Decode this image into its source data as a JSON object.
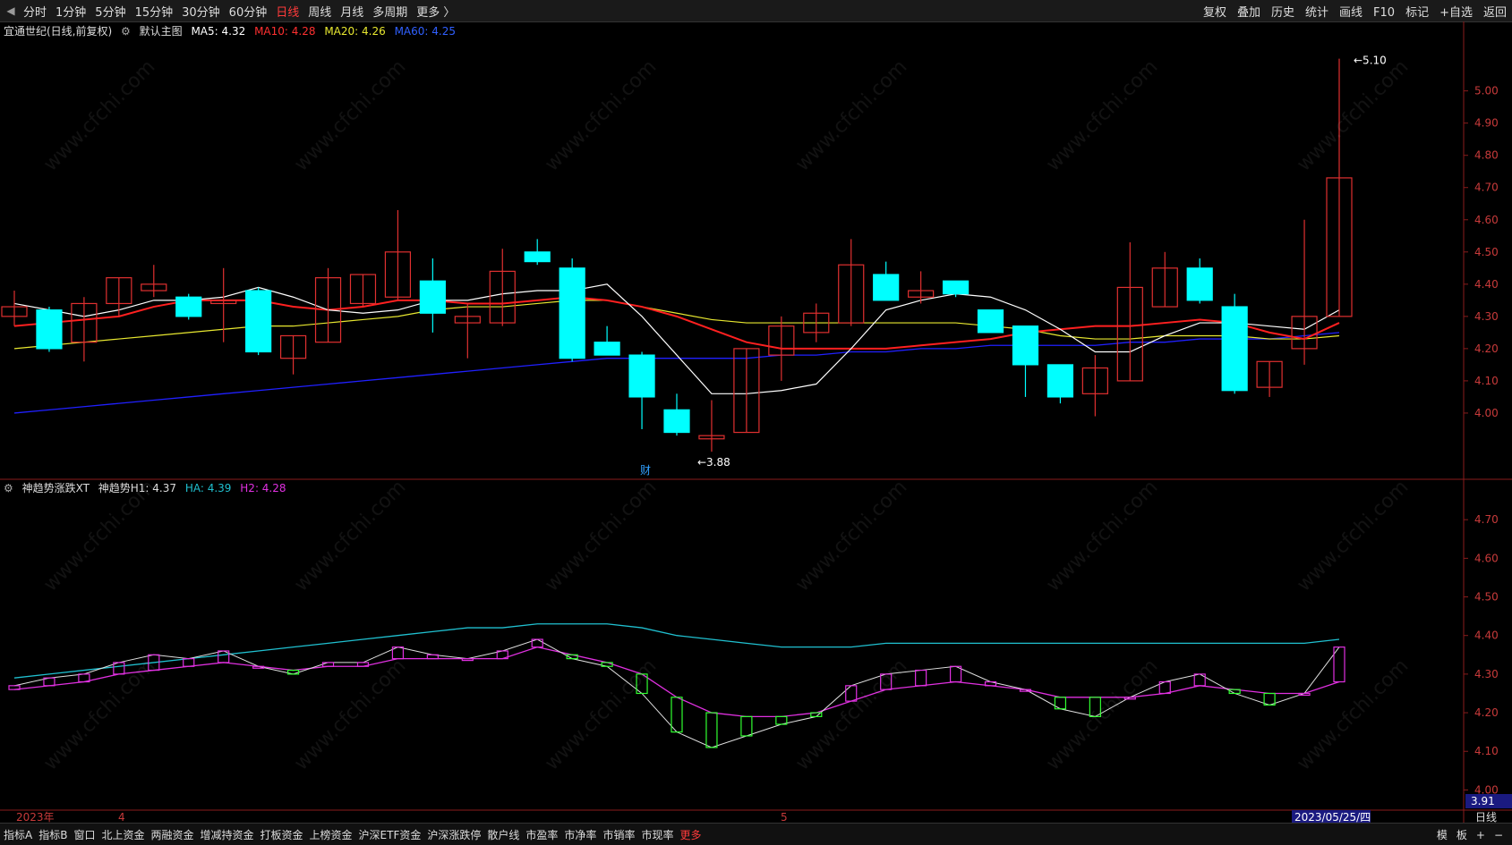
{
  "topbar": {
    "nav": [
      "分时",
      "1分钟",
      "5分钟",
      "15分钟",
      "30分钟",
      "60分钟",
      "日线",
      "周线",
      "月线",
      "多周期",
      "更多 〉"
    ],
    "active_index": 6,
    "tools": [
      "复权",
      "叠加",
      "历史",
      "统计",
      "画线",
      "F10",
      "标记",
      "+自选",
      "返回"
    ]
  },
  "main_info": {
    "stock": "宜通世纪(日线,前复权)",
    "indicator": "默认主图",
    "ma5": "MA5: 4.32",
    "ma10": "MA10: 4.28",
    "ma20": "MA20: 4.26",
    "ma60": "MA60: 4.25"
  },
  "sub_info": {
    "name": "神趋势涨跌XT",
    "h1": "神趋势H1: 4.37",
    "ha": "HA: 4.39",
    "h2": "H2: 4.28"
  },
  "colors": {
    "ma5": "#ffffff",
    "ma10": "#ff2020",
    "ma20": "#e8e830",
    "ma60": "#2020ff",
    "up": "#e03030",
    "down": "#00ffff",
    "ha": "#20c0d0",
    "h2": "#e030e0"
  },
  "main_axis": [
    "5.00",
    "4.90",
    "4.80",
    "4.70",
    "4.60",
    "4.50",
    "4.40",
    "4.30",
    "4.20",
    "4.10",
    "4.00"
  ],
  "sub_axis": [
    "4.70",
    "4.60",
    "4.50",
    "4.40",
    "4.30",
    "4.20",
    "4.10",
    "4.00"
  ],
  "annotations": {
    "high": "5.10",
    "low": "3.88",
    "fin": "财",
    "cursor_value": "3.91"
  },
  "time_axis": {
    "year": "2023年",
    "m4": "4",
    "m5": "5",
    "cursor_date": "2023/05/25/四",
    "period": "日线"
  },
  "bottombar": {
    "tabs": [
      "指标A",
      "指标B",
      "窗口",
      "北上资金",
      "两融资金",
      "增减持资金",
      "打板资金",
      "上榜资金",
      "沪深ETF资金",
      "沪深涨跌停",
      "散户线",
      "市盈率",
      "市净率",
      "市销率",
      "市现率",
      "更多"
    ],
    "right": [
      "模",
      "板",
      "+",
      "−"
    ]
  },
  "watermark": "www.cfchi.com",
  "chart_data": {
    "type": "candlestick",
    "candles": [
      {
        "o": 4.3,
        "c": 4.33,
        "h": 4.38,
        "l": 4.27
      },
      {
        "o": 4.32,
        "c": 4.2,
        "h": 4.33,
        "l": 4.19
      },
      {
        "o": 4.22,
        "c": 4.34,
        "h": 4.36,
        "l": 4.16
      },
      {
        "o": 4.34,
        "c": 4.42,
        "h": 4.42,
        "l": 4.3
      },
      {
        "o": 4.38,
        "c": 4.4,
        "h": 4.46,
        "l": 4.36
      },
      {
        "o": 4.36,
        "c": 4.3,
        "h": 4.37,
        "l": 4.29
      },
      {
        "o": 4.34,
        "c": 4.35,
        "h": 4.45,
        "l": 4.22
      },
      {
        "o": 4.38,
        "c": 4.19,
        "h": 4.39,
        "l": 4.18
      },
      {
        "o": 4.17,
        "c": 4.24,
        "h": 4.24,
        "l": 4.12
      },
      {
        "o": 4.22,
        "c": 4.42,
        "h": 4.45,
        "l": 4.22
      },
      {
        "o": 4.34,
        "c": 4.43,
        "h": 4.43,
        "l": 4.33
      },
      {
        "o": 4.36,
        "c": 4.5,
        "h": 4.63,
        "l": 4.35
      },
      {
        "o": 4.41,
        "c": 4.31,
        "h": 4.48,
        "l": 4.25
      },
      {
        "o": 4.28,
        "c": 4.3,
        "h": 4.34,
        "l": 4.17
      },
      {
        "o": 4.28,
        "c": 4.44,
        "h": 4.51,
        "l": 4.27
      },
      {
        "o": 4.5,
        "c": 4.47,
        "h": 4.54,
        "l": 4.46
      },
      {
        "o": 4.45,
        "c": 4.17,
        "h": 4.48,
        "l": 4.16
      },
      {
        "o": 4.22,
        "c": 4.18,
        "h": 4.27,
        "l": 4.18
      },
      {
        "o": 4.18,
        "c": 4.05,
        "h": 4.19,
        "l": 3.95
      },
      {
        "o": 4.01,
        "c": 3.94,
        "h": 4.06,
        "l": 3.93
      },
      {
        "o": 3.92,
        "c": 3.93,
        "h": 4.04,
        "l": 3.88
      },
      {
        "o": 3.94,
        "c": 4.2,
        "h": 4.2,
        "l": 3.94
      },
      {
        "o": 4.18,
        "c": 4.27,
        "h": 4.3,
        "l": 4.1
      },
      {
        "o": 4.25,
        "c": 4.31,
        "h": 4.34,
        "l": 4.22
      },
      {
        "o": 4.28,
        "c": 4.46,
        "h": 4.54,
        "l": 4.27
      },
      {
        "o": 4.43,
        "c": 4.35,
        "h": 4.47,
        "l": 4.35
      },
      {
        "o": 4.36,
        "c": 4.38,
        "h": 4.44,
        "l": 4.34
      },
      {
        "o": 4.41,
        "c": 4.37,
        "h": 4.41,
        "l": 4.36
      },
      {
        "o": 4.32,
        "c": 4.25,
        "h": 4.32,
        "l": 4.25
      },
      {
        "o": 4.27,
        "c": 4.15,
        "h": 4.27,
        "l": 4.05
      },
      {
        "o": 4.15,
        "c": 4.05,
        "h": 4.15,
        "l": 4.03
      },
      {
        "o": 4.06,
        "c": 4.14,
        "h": 4.18,
        "l": 3.99
      },
      {
        "o": 4.1,
        "c": 4.39,
        "h": 4.53,
        "l": 4.1
      },
      {
        "o": 4.33,
        "c": 4.45,
        "h": 4.5,
        "l": 4.33
      },
      {
        "o": 4.45,
        "c": 4.35,
        "h": 4.48,
        "l": 4.34
      },
      {
        "o": 4.33,
        "c": 4.07,
        "h": 4.37,
        "l": 4.06
      },
      {
        "o": 4.08,
        "c": 4.16,
        "h": 4.16,
        "l": 4.05
      },
      {
        "o": 4.2,
        "c": 4.3,
        "h": 4.6,
        "l": 4.15
      },
      {
        "o": 4.3,
        "c": 4.73,
        "h": 5.1,
        "l": 4.3
      }
    ],
    "ma5": [
      4.34,
      4.32,
      4.3,
      4.32,
      4.35,
      4.35,
      4.36,
      4.39,
      4.36,
      4.32,
      4.31,
      4.32,
      4.35,
      4.35,
      4.37,
      4.38,
      4.38,
      4.4,
      4.3,
      4.18,
      4.06,
      4.06,
      4.07,
      4.09,
      4.2,
      4.32,
      4.35,
      4.37,
      4.36,
      4.32,
      4.26,
      4.19,
      4.19,
      4.24,
      4.28,
      4.28,
      4.27,
      4.26,
      4.32
    ],
    "ma10": [
      4.27,
      4.28,
      4.29,
      4.3,
      4.33,
      4.35,
      4.35,
      4.35,
      4.33,
      4.32,
      4.33,
      4.35,
      4.35,
      4.34,
      4.34,
      4.35,
      4.36,
      4.35,
      4.33,
      4.3,
      4.26,
      4.22,
      4.2,
      4.2,
      4.2,
      4.2,
      4.21,
      4.22,
      4.23,
      4.25,
      4.26,
      4.27,
      4.27,
      4.28,
      4.29,
      4.28,
      4.25,
      4.23,
      4.28
    ],
    "ma20": [
      4.2,
      4.21,
      4.22,
      4.23,
      4.24,
      4.25,
      4.26,
      4.27,
      4.27,
      4.28,
      4.29,
      4.3,
      4.32,
      4.33,
      4.33,
      4.34,
      4.35,
      4.35,
      4.33,
      4.31,
      4.29,
      4.28,
      4.28,
      4.28,
      4.28,
      4.28,
      4.28,
      4.28,
      4.27,
      4.26,
      4.24,
      4.23,
      4.23,
      4.24,
      4.24,
      4.24,
      4.23,
      4.23,
      4.24
    ],
    "ma60": [
      4.0,
      4.01,
      4.02,
      4.03,
      4.04,
      4.05,
      4.06,
      4.07,
      4.08,
      4.09,
      4.1,
      4.11,
      4.12,
      4.13,
      4.14,
      4.15,
      4.16,
      4.17,
      4.17,
      4.17,
      4.17,
      4.17,
      4.18,
      4.18,
      4.19,
      4.19,
      4.2,
      4.2,
      4.21,
      4.21,
      4.21,
      4.21,
      4.22,
      4.22,
      4.23,
      4.23,
      4.23,
      4.24,
      4.25
    ],
    "ha": [
      4.29,
      4.3,
      4.31,
      4.32,
      4.33,
      4.34,
      4.35,
      4.36,
      4.37,
      4.38,
      4.39,
      4.4,
      4.41,
      4.42,
      4.42,
      4.43,
      4.43,
      4.43,
      4.42,
      4.4,
      4.39,
      4.38,
      4.37,
      4.37,
      4.37,
      4.38,
      4.38,
      4.38,
      4.38,
      4.38,
      4.38,
      4.38,
      4.38,
      4.38,
      4.38,
      4.38,
      4.38,
      4.38,
      4.39
    ],
    "h1": [
      4.27,
      4.29,
      4.3,
      4.33,
      4.35,
      4.34,
      4.36,
      4.32,
      4.3,
      4.33,
      4.33,
      4.37,
      4.35,
      4.34,
      4.36,
      4.39,
      4.34,
      4.32,
      4.25,
      4.15,
      4.11,
      4.14,
      4.17,
      4.19,
      4.27,
      4.3,
      4.31,
      4.32,
      4.28,
      4.26,
      4.21,
      4.19,
      4.24,
      4.28,
      4.3,
      4.25,
      4.22,
      4.25,
      4.37
    ],
    "h2": [
      4.26,
      4.27,
      4.28,
      4.3,
      4.31,
      4.32,
      4.33,
      4.32,
      4.31,
      4.32,
      4.32,
      4.34,
      4.34,
      4.34,
      4.34,
      4.37,
      4.35,
      4.33,
      4.3,
      4.24,
      4.2,
      4.19,
      4.19,
      4.2,
      4.23,
      4.26,
      4.27,
      4.28,
      4.27,
      4.26,
      4.24,
      4.24,
      4.24,
      4.25,
      4.27,
      4.26,
      4.25,
      4.25,
      4.28
    ],
    "main_ylim": [
      3.8,
      5.16
    ],
    "sub_ylim": [
      3.95,
      4.8
    ]
  }
}
